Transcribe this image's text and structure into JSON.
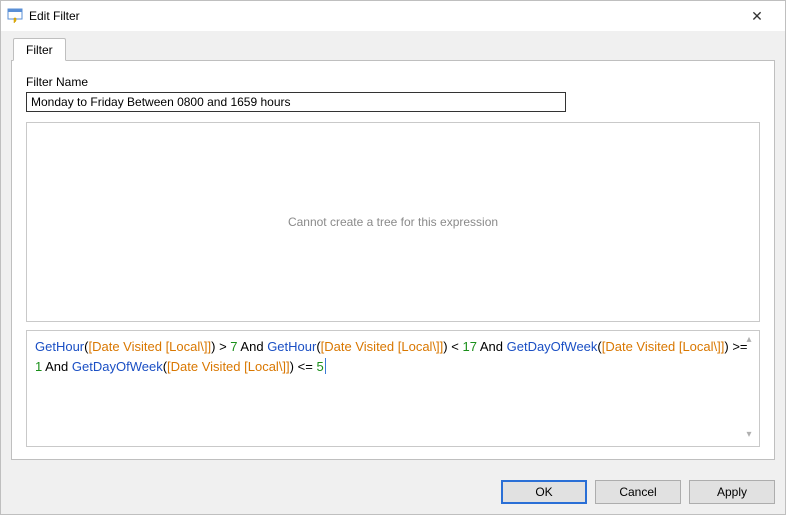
{
  "window": {
    "title": "Edit Filter"
  },
  "tabs": {
    "filter_label": "Filter"
  },
  "fields": {
    "filter_name_label": "Filter Name",
    "filter_name_value": "Monday to Friday Between 0800 and 1659 hours"
  },
  "tree": {
    "empty_message": "Cannot create a tree for this expression"
  },
  "expression": {
    "tokens": [
      {
        "t": "func",
        "v": "GetHour"
      },
      {
        "t": "paren",
        "v": "("
      },
      {
        "t": "field",
        "v": "[Date Visited [Local\\]]"
      },
      {
        "t": "paren",
        "v": ")"
      },
      {
        "t": "sp",
        "v": " "
      },
      {
        "t": "op",
        "v": ">"
      },
      {
        "t": "sp",
        "v": " "
      },
      {
        "t": "num",
        "v": "7"
      },
      {
        "t": "sp",
        "v": " "
      },
      {
        "t": "kw",
        "v": "And"
      },
      {
        "t": "sp",
        "v": " "
      },
      {
        "t": "func",
        "v": "GetHour"
      },
      {
        "t": "paren",
        "v": "("
      },
      {
        "t": "field",
        "v": "[Date Visited [Local\\]]"
      },
      {
        "t": "paren",
        "v": ")"
      },
      {
        "t": "sp",
        "v": " "
      },
      {
        "t": "op",
        "v": "<"
      },
      {
        "t": "sp",
        "v": " "
      },
      {
        "t": "num",
        "v": "17"
      },
      {
        "t": "sp",
        "v": " "
      },
      {
        "t": "kw",
        "v": "And"
      },
      {
        "t": "sp",
        "v": " "
      },
      {
        "t": "func",
        "v": "GetDayOfWeek"
      },
      {
        "t": "paren",
        "v": "("
      },
      {
        "t": "field",
        "v": "[Date Visited [Local\\]]"
      },
      {
        "t": "paren",
        "v": ")"
      },
      {
        "t": "sp",
        "v": " "
      },
      {
        "t": "op",
        "v": ">="
      },
      {
        "t": "sp",
        "v": " "
      },
      {
        "t": "num",
        "v": "1"
      },
      {
        "t": "sp",
        "v": " "
      },
      {
        "t": "kw",
        "v": "And"
      },
      {
        "t": "sp",
        "v": " "
      },
      {
        "t": "func",
        "v": "GetDayOfWeek"
      },
      {
        "t": "paren",
        "v": "("
      },
      {
        "t": "field",
        "v": "[Date Visited [Local\\]]"
      },
      {
        "t": "paren",
        "v": ")"
      },
      {
        "t": "sp",
        "v": " "
      },
      {
        "t": "op",
        "v": "<="
      },
      {
        "t": "sp",
        "v": " "
      },
      {
        "t": "num",
        "v": "5"
      }
    ]
  },
  "buttons": {
    "ok": "OK",
    "cancel": "Cancel",
    "apply": "Apply"
  },
  "glyphs": {
    "close": "✕",
    "up": "▴",
    "down": "▾"
  }
}
